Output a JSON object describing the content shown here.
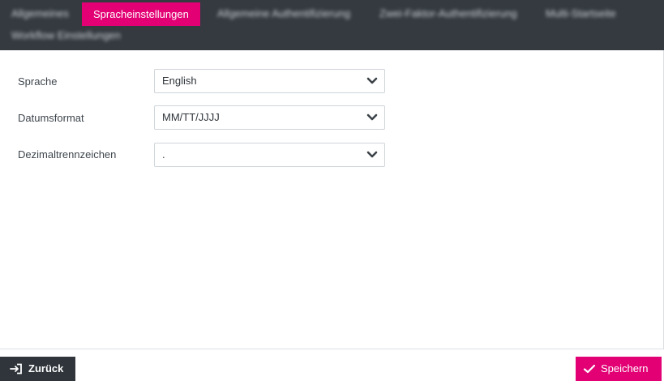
{
  "tabs": {
    "general": "Allgemeines",
    "language": "Spracheinstellungen",
    "auth": "Allgemeine Authentifizierung",
    "twofactor": "Zwei-Faktor-Authentifizierung",
    "multi": "Multi-Startseite",
    "workflow": "Workflow Einstellungen"
  },
  "form": {
    "language": {
      "label": "Sprache",
      "value": "English"
    },
    "date_format": {
      "label": "Datumsformat",
      "value": "MM/TT/JJJJ"
    },
    "decimal_separator": {
      "label": "Dezimaltrennzeichen",
      "value": "."
    }
  },
  "footer": {
    "back_label": "Zurück",
    "save_label": "Speichern"
  },
  "icons": {
    "back": "sign-in-arrow-icon",
    "save": "check-icon",
    "dropdown": "chevron-down-icon"
  },
  "colors": {
    "accent": "#e20074",
    "tabbar_bg": "#343a40",
    "back_button_bg": "#2f353a"
  }
}
